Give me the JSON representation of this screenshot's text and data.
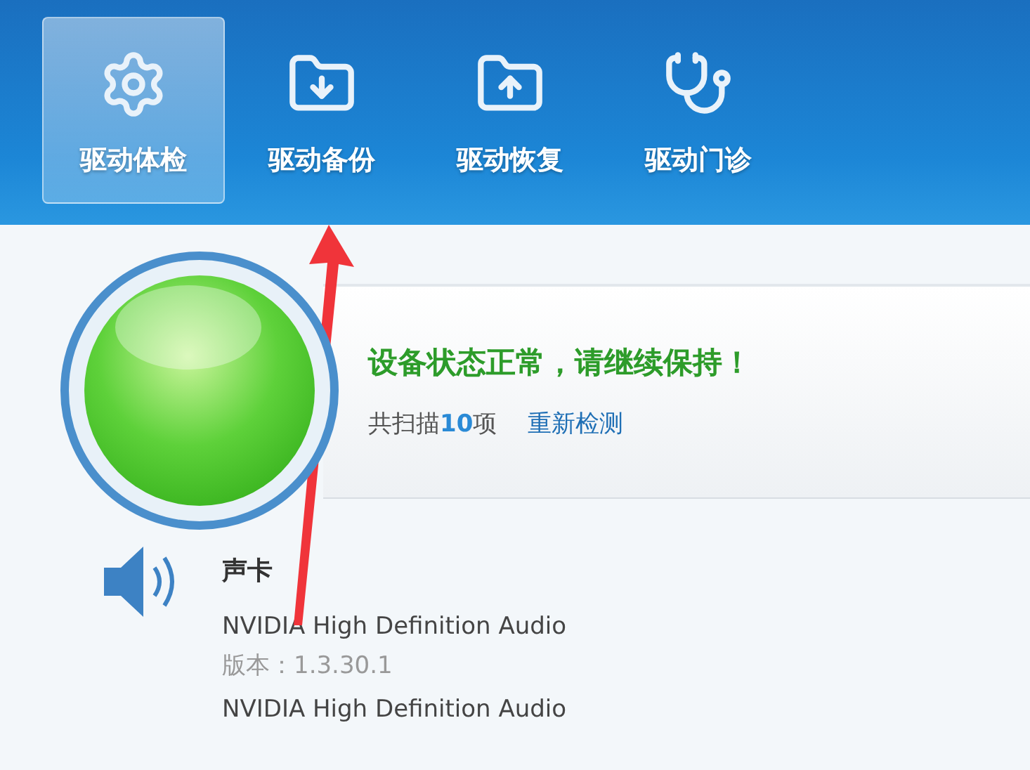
{
  "tabs": [
    {
      "label": "驱动体检",
      "selected": true
    },
    {
      "label": "驱动备份",
      "selected": false
    },
    {
      "label": "驱动恢复",
      "selected": false
    },
    {
      "label": "驱动门诊",
      "selected": false
    }
  ],
  "status": {
    "title": "设备状态正常，请继续保持！",
    "summary": "共扫描**10**项",
    "action": "重新检测"
  },
  "devices": [
    {
      "category": "声卡",
      "name": "NVIDIA High Definition Audio",
      "version": "版本：1.3.30.1"
    },
    {
      "name": "NVIDIA High Definition Audio"
    }
  ]
}
